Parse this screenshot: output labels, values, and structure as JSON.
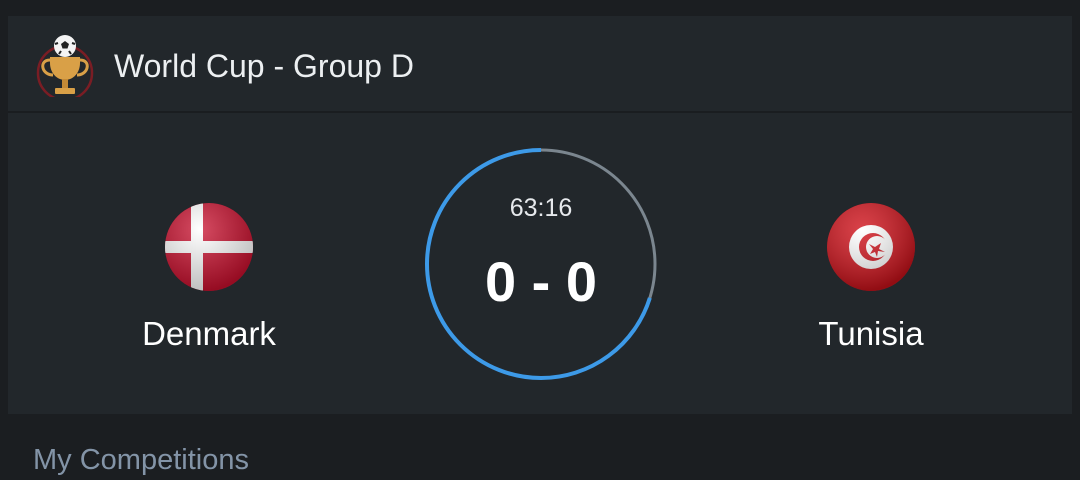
{
  "competition": {
    "title": "World Cup - Group D",
    "icon": "trophy-ball-icon"
  },
  "match": {
    "home": {
      "name": "Denmark",
      "flag": "denmark-flag-icon"
    },
    "away": {
      "name": "Tunisia",
      "flag": "tunisia-flag-icon"
    },
    "clock": "63:16",
    "score": "0 - 0",
    "progress": 0.702
  },
  "sections": {
    "my_competitions": "My Competitions"
  },
  "colors": {
    "background": "#1b1e21",
    "card": "#22272b",
    "progress": "#3d9ae8",
    "track": "#7b868f",
    "section_label": "#8394a7"
  }
}
